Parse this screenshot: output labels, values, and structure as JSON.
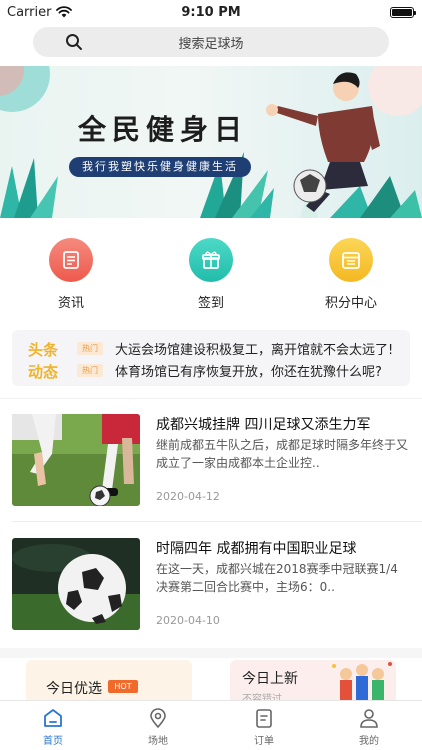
{
  "status_bar": {
    "carrier": "Carrier",
    "time": "9:10 PM"
  },
  "search": {
    "placeholder": "搜索足球场"
  },
  "banner": {
    "title": "全民健身日",
    "subtitle": "我行我塑快乐健身健康生活"
  },
  "quick_menu": [
    {
      "label": "资讯",
      "icon": "news-icon",
      "color": "#f06a5d"
    },
    {
      "label": "签到",
      "icon": "gift-icon",
      "color": "#2fcbb7"
    },
    {
      "label": "积分中心",
      "icon": "calendar-icon",
      "color": "#f7c23a"
    }
  ],
  "ticker": {
    "tags": [
      "头条",
      "动态"
    ],
    "hot_label": "热门",
    "items": [
      "大运会场馆建设积极复工，离开馆就不会太远了!",
      "体育场馆已有序恢复开放，你还在犹豫什么呢?"
    ]
  },
  "articles": [
    {
      "title": "成都兴城挂牌 四川足球又添生力军",
      "summary": "继前成都五牛队之后，成都足球时隔多年终于又成立了一家由成都本土企业控..",
      "date": "2020-04-12"
    },
    {
      "title": "时隔四年 成都拥有中国职业足球",
      "summary": "在这一天，成都兴城在2018赛季中冠联赛1/4决赛第二回合比赛中，主场6：0..",
      "date": "2020-04-10"
    }
  ],
  "promos": [
    {
      "title": "今日优选",
      "badge": "HOT",
      "subtitle": ""
    },
    {
      "title": "今日上新",
      "badge": "",
      "subtitle": "不容错过"
    }
  ],
  "tabbar": [
    {
      "label": "首页",
      "icon": "home-icon",
      "active": true
    },
    {
      "label": "场地",
      "icon": "location-icon",
      "active": false
    },
    {
      "label": "订单",
      "icon": "order-icon",
      "active": false
    },
    {
      "label": "我的",
      "icon": "user-icon",
      "active": false
    }
  ],
  "colors": {
    "accent": "#2a76d2",
    "ticker_tag": "#f0b32b",
    "hot_badge": "#f06a2c"
  }
}
